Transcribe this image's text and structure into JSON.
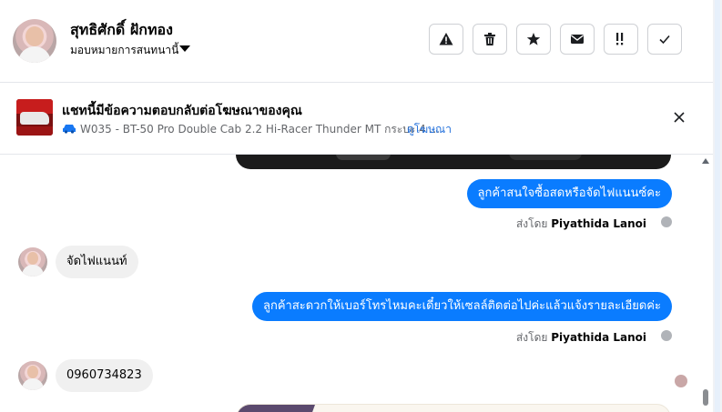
{
  "header": {
    "contact_name": "สุทธิศักดิ์ ฝักทอง",
    "assign_label": "มอบหมายการสนทนานี้",
    "actions": [
      {
        "name": "report-button",
        "icon": "warning-icon"
      },
      {
        "name": "delete-button",
        "icon": "trash-icon"
      },
      {
        "name": "star-button",
        "icon": "star-icon"
      },
      {
        "name": "mark-unread-button",
        "icon": "envelope-icon"
      },
      {
        "name": "follow-up-button",
        "icon": "exclamation-icon"
      },
      {
        "name": "done-button",
        "icon": "check-icon"
      }
    ]
  },
  "ad_banner": {
    "title": "แชทนี้มีข้อความตอบกลับต่อโฆษณาของคุณ",
    "subtitle": "W035 - BT-50 Pro Double Cab 2.2 Hi-Racer Thunder MT กระบะ 4 ...",
    "link": "ดูโฆษณา"
  },
  "messages": {
    "out1": "ลูกค้าสนใจซื้อสดหรือจัดไฟแนนซ์คะ",
    "sent_by1_prefix": "ส่งโดย",
    "sent_by1_name": "Piyathida Lanoi",
    "in1": "จัดไฟแนนท์",
    "out2": "ลูกค้าสะดวกให้เบอร์โทรไหมคะเดี๋ยวให้เซลล์ติดต่อไปค่ะแล้วแจ้งรายละเอียดค่ะ",
    "sent_by2_prefix": "ส่งโดย",
    "sent_by2_name": "Piyathida Lanoi",
    "in2": "0960734823"
  },
  "colors": {
    "outgoing_bubble": "#0a7cff",
    "incoming_bubble": "#f0f0f0",
    "link": "#216fdb"
  }
}
